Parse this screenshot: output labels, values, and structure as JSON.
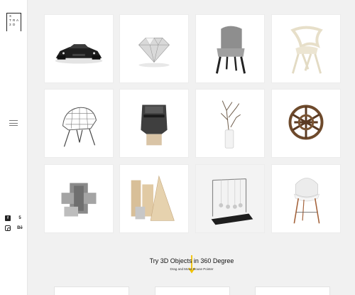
{
  "brand": {
    "logo_letters": [
      "X",
      "",
      "",
      "T",
      "R",
      "A",
      "3",
      "D",
      ""
    ]
  },
  "sidebar": {
    "menu_icon": "hamburger-icon",
    "social": [
      {
        "icon": "facebook-icon",
        "glyph": "f"
      },
      {
        "icon": "500px-icon",
        "glyph": "5"
      },
      {
        "icon": "instagram-icon",
        "glyph": ""
      },
      {
        "icon": "behance-icon",
        "glyph": "Bē"
      }
    ]
  },
  "objects": [
    {
      "name": "Black supercar"
    },
    {
      "name": "Diamond"
    },
    {
      "name": "Grey lounge chair"
    },
    {
      "name": "Organic white chair"
    },
    {
      "name": "Wire chair"
    },
    {
      "name": "Knight helmet bust"
    },
    {
      "name": "Branches in vase"
    },
    {
      "name": "Wooden lattice sphere"
    },
    {
      "name": "Metal puzzle cube"
    },
    {
      "name": "Wood geometric shapes"
    },
    {
      "name": "Newton's cradle"
    },
    {
      "name": "White bar stool"
    }
  ],
  "cta": {
    "headline": "Try 3D Objects in 360 Degree",
    "subline": "Drag and Move Mouse Pointer",
    "accent": "#f2c200"
  }
}
